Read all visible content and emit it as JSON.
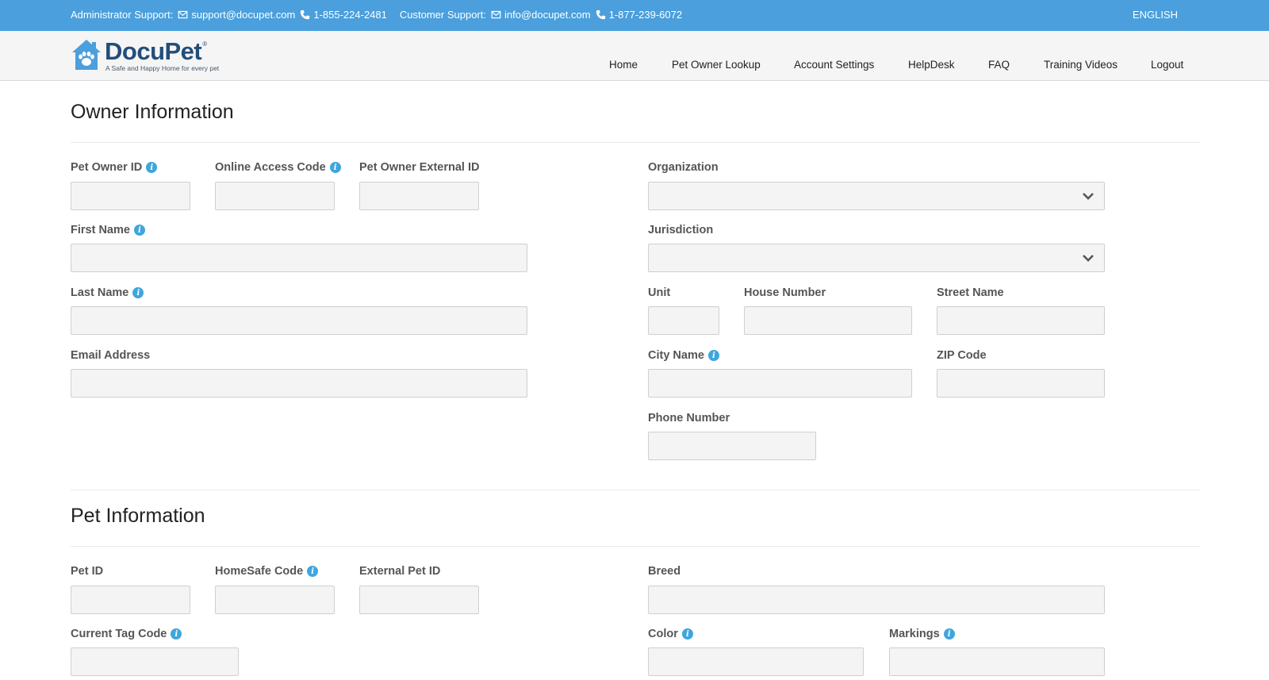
{
  "topbar": {
    "admin_label": "Administrator Support:",
    "admin_email": "support@docupet.com",
    "admin_phone": "1-855-224-2481",
    "customer_label": "Customer Support:",
    "customer_email": "info@docupet.com",
    "customer_phone": "1-877-239-6072",
    "language": "ENGLISH"
  },
  "logo": {
    "brand": "DocuPet",
    "reg": "®",
    "tagline": "A Safe and Happy Home for every pet"
  },
  "nav": {
    "items": [
      "Home",
      "Pet Owner Lookup",
      "Account Settings",
      "HelpDesk",
      "FAQ",
      "Training Videos",
      "Logout"
    ]
  },
  "owner": {
    "title": "Owner Information",
    "pet_owner_id": {
      "label": "Pet Owner ID",
      "value": ""
    },
    "online_access_code": {
      "label": "Online Access Code",
      "value": ""
    },
    "pet_owner_external_id": {
      "label": "Pet Owner External ID",
      "value": ""
    },
    "first_name": {
      "label": "First Name",
      "value": ""
    },
    "last_name": {
      "label": "Last Name",
      "value": ""
    },
    "email": {
      "label": "Email Address",
      "value": ""
    },
    "organization": {
      "label": "Organization",
      "value": ""
    },
    "jurisdiction": {
      "label": "Jurisdiction",
      "value": ""
    },
    "unit": {
      "label": "Unit",
      "value": ""
    },
    "house_number": {
      "label": "House Number",
      "value": ""
    },
    "street_name": {
      "label": "Street Name",
      "value": ""
    },
    "city_name": {
      "label": "City Name",
      "value": ""
    },
    "zip_code": {
      "label": "ZIP Code",
      "value": ""
    },
    "phone_number": {
      "label": "Phone Number",
      "value": ""
    }
  },
  "pet": {
    "title": "Pet Information",
    "pet_id": {
      "label": "Pet ID",
      "value": ""
    },
    "homesafe_code": {
      "label": "HomeSafe Code",
      "value": ""
    },
    "external_pet_id": {
      "label": "External Pet ID",
      "value": ""
    },
    "current_tag_code": {
      "label": "Current Tag Code",
      "value": ""
    },
    "breed": {
      "label": "Breed",
      "value": ""
    },
    "color": {
      "label": "Color",
      "value": ""
    },
    "markings": {
      "label": "Markings",
      "value": ""
    }
  },
  "colors": {
    "topbar": "#4a9fdc",
    "brand": "#224e7a",
    "info_icon": "#3fa6dd",
    "field_bg": "#f4f4f4"
  },
  "icons": {
    "info": "i",
    "email": "envelope-icon",
    "phone": "phone-icon",
    "dropdown": "chevron-down-icon",
    "logo": "house-paw-icon"
  }
}
